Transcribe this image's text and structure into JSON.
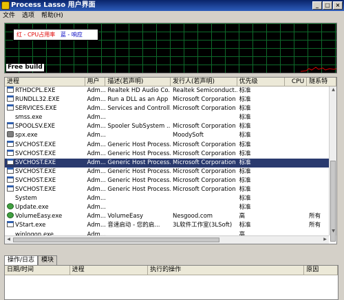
{
  "window": {
    "title": "Process Lasso 用户界面"
  },
  "menu": [
    "文件",
    "选项",
    "帮助(H)"
  ],
  "graph": {
    "legend_red": "红 - CPU占用率",
    "legend_blue": "蓝 - 响应",
    "build_label": "Free build",
    "grid_color": "#0e6a2a",
    "line_color": "#e00000"
  },
  "table": {
    "columns": [
      "进程",
      "用户",
      "描述(若声明)",
      "发行人(若声明)",
      "优先级",
      "CPU",
      "隧系特"
    ],
    "rows": [
      {
        "icon": "exe",
        "process": "RTHDCPL.EXE",
        "user": "Adm...",
        "desc": "Realtek HD Audio Co...",
        "publisher": "Realtek Semiconduct...",
        "priority": "标准",
        "cpu": "",
        "extra": ""
      },
      {
        "icon": "exe",
        "process": "RUNDLL32.EXE",
        "user": "Adm...",
        "desc": "Run a DLL as an App",
        "publisher": "Microsoft Corporation",
        "priority": "标准",
        "cpu": "",
        "extra": ""
      },
      {
        "icon": "exe",
        "process": "SERVICES.EXE",
        "user": "Adm...",
        "desc": "Services and Controll...",
        "publisher": "Microsoft Corporation",
        "priority": "标准",
        "cpu": "",
        "extra": ""
      },
      {
        "icon": "none",
        "process": "smss.exe",
        "user": "Adm...",
        "desc": "",
        "publisher": "",
        "priority": "标准",
        "cpu": "",
        "extra": ""
      },
      {
        "icon": "exe",
        "process": "SPOOLSV.EXE",
        "user": "Adm...",
        "desc": "Spooler SubSystem ...",
        "publisher": "Microsoft Corporation",
        "priority": "标准",
        "cpu": "",
        "extra": ""
      },
      {
        "icon": "gear",
        "process": "spx.exe",
        "user": "Adm...",
        "desc": "",
        "publisher": "MoodySoft",
        "priority": "标准",
        "cpu": "",
        "extra": ""
      },
      {
        "icon": "exe",
        "process": "SVCHOST.EXE",
        "user": "Adm...",
        "desc": "Generic Host Process...",
        "publisher": "Microsoft Corporation",
        "priority": "标准",
        "cpu": "",
        "extra": ""
      },
      {
        "icon": "exe",
        "process": "SVCHOST.EXE",
        "user": "Adm...",
        "desc": "Generic Host Process...",
        "publisher": "Microsoft Corporation",
        "priority": "标准",
        "cpu": "",
        "extra": ""
      },
      {
        "icon": "exe",
        "process": "SVCHOST.EXE",
        "user": "Adm...",
        "desc": "Generic Host Process...",
        "publisher": "Microsoft Corporation",
        "priority": "标准",
        "cpu": "",
        "extra": ""
      },
      {
        "icon": "exe",
        "process": "SVCHOST.EXE",
        "user": "Adm...",
        "desc": "Generic Host Process...",
        "publisher": "Microsoft Corporation",
        "priority": "标准",
        "cpu": "",
        "extra": ""
      },
      {
        "icon": "exe",
        "process": "SVCHOST.EXE",
        "user": "Adm...",
        "desc": "Generic Host Process...",
        "publisher": "Microsoft Corporation",
        "priority": "标准",
        "cpu": "",
        "extra": ""
      },
      {
        "icon": "exe",
        "process": "SVCHOST.EXE",
        "user": "Adm...",
        "desc": "Generic Host Process...",
        "publisher": "Microsoft Corporation",
        "priority": "标准",
        "cpu": "",
        "extra": ""
      },
      {
        "icon": "none",
        "process": "System",
        "user": "Adm...",
        "desc": "",
        "publisher": "",
        "priority": "标准",
        "cpu": "",
        "extra": ""
      },
      {
        "icon": "round",
        "process": "Update.exe",
        "user": "Adm...",
        "desc": "",
        "publisher": "",
        "priority": "标准",
        "cpu": "",
        "extra": ""
      },
      {
        "icon": "round",
        "process": "VolumeEasy.exe",
        "user": "Adm...",
        "desc": "VolumeEasy",
        "publisher": "Nesgood.com",
        "priority": "高",
        "cpu": "",
        "extra": "所有"
      },
      {
        "icon": "exe",
        "process": "VStart.exe",
        "user": "Adm...",
        "desc": "音速启动 - 您的启...",
        "publisher": "3L软件工作室(3LSoft)",
        "priority": "标准",
        "cpu": "",
        "extra": "所有"
      },
      {
        "icon": "none",
        "process": "winlogon.exe",
        "user": "Adm...",
        "desc": "",
        "publisher": "",
        "priority": "高",
        "cpu": "",
        "extra": ""
      }
    ],
    "selected_index": 8
  },
  "tabs": [
    "操作/日志",
    "模块"
  ],
  "log": {
    "columns": [
      "日期/时间",
      "进程",
      "执行的操作",
      "原因"
    ]
  },
  "colors": {
    "title_bar": "#0a246a",
    "selection": "#2a3a6e"
  }
}
